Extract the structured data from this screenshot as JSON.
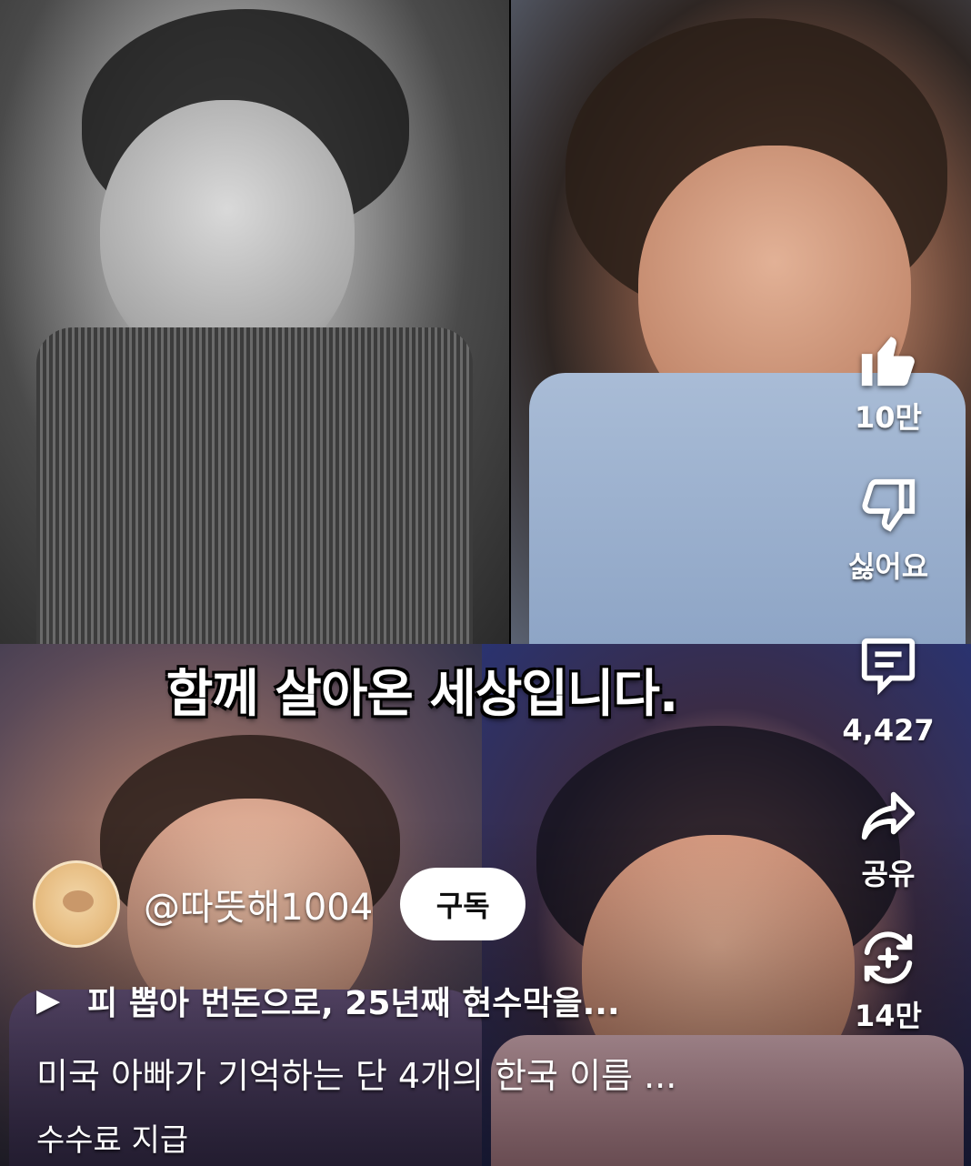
{
  "caption": "함께 살아온 세상입니다.",
  "actions": {
    "like": {
      "icon": "thumbs-up-icon",
      "label": "10만"
    },
    "dislike": {
      "icon": "thumbs-down-icon",
      "label": "싫어요"
    },
    "comments": {
      "icon": "comment-icon",
      "label": "4,427"
    },
    "share": {
      "icon": "share-icon",
      "label": "공유"
    },
    "remix": {
      "icon": "remix-icon",
      "label": "14만"
    }
  },
  "channel": {
    "handle": "@따뜻해1004",
    "subscribe_label": "구독"
  },
  "related": {
    "play_icon": "▶",
    "text": "피 뽑아 번돈으로, 25년째 현수막을..."
  },
  "title": "미국 아빠가 기억하는 단 4개의 한국 이름 ...",
  "sponsor": "수수료 지급",
  "colors": {
    "text": "#ffffff",
    "subscribe_bg": "#ffffff",
    "subscribe_text": "#0f0f0f"
  }
}
